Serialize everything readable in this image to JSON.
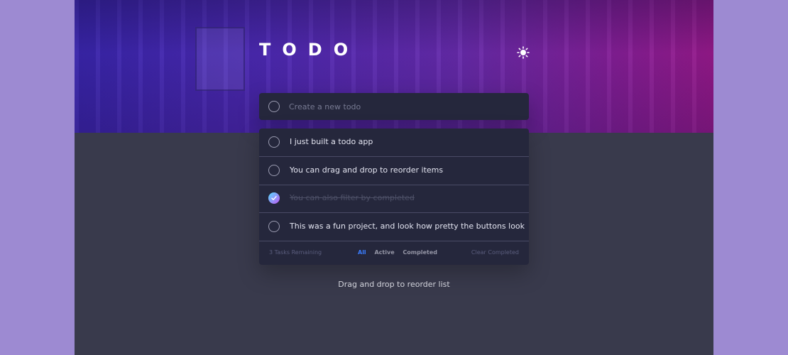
{
  "header": {
    "title": "TODO",
    "theme_icon": "sun-icon"
  },
  "new_todo": {
    "placeholder": "Create a new todo",
    "value": ""
  },
  "todos": [
    {
      "text": "I just built a todo app",
      "completed": false
    },
    {
      "text": "You can drag and drop to reorder items",
      "completed": false
    },
    {
      "text": "You can also filter by completed",
      "completed": true
    },
    {
      "text": "This was a fun project, and look how pretty the buttons look",
      "completed": false
    }
  ],
  "footer": {
    "remaining": "3 Tasks Remaining",
    "filters": [
      "All",
      "Active",
      "Completed"
    ],
    "active_filter": "All",
    "clear_label": "Clear Completed"
  },
  "hint": "Drag and drop to reorder list",
  "colors": {
    "accent": "#3a7cfd",
    "panel": "#25273c",
    "background": "#393a4c",
    "page": "#9d8ad2",
    "check_gradient_start": "#57ddff",
    "check_gradient_end": "#c058f3"
  }
}
